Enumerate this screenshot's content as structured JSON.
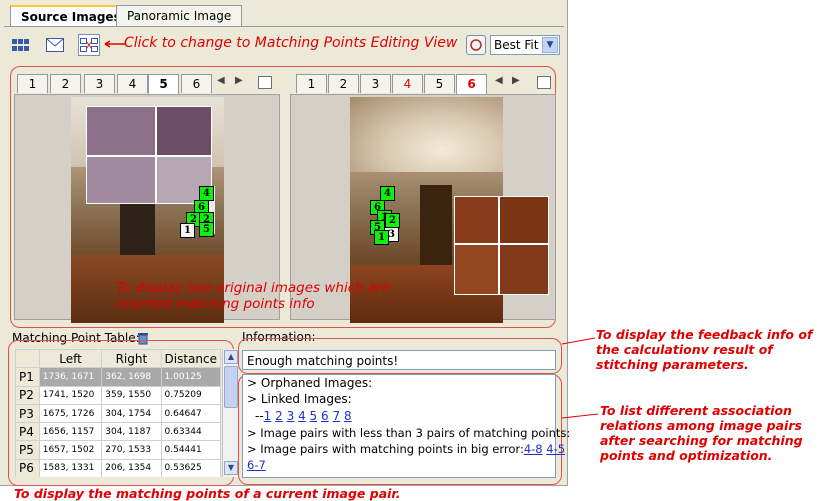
{
  "tabs": {
    "source_images": "Source Images",
    "panoramic_image": "Panoramic Image"
  },
  "toolbar": {
    "zoom_select": "Best Fit"
  },
  "instruction": "Click to change to Matching Points Editing View",
  "left_tabs": [
    "1",
    "2",
    "3",
    "4",
    "5",
    "6"
  ],
  "right_tabs": [
    "1",
    "2",
    "3",
    "4",
    "5",
    "6"
  ],
  "left_markers": [
    "4",
    "6",
    "2",
    "2",
    "5",
    "1"
  ],
  "right_markers": [
    "4",
    "6",
    "1",
    "2",
    "5",
    "3",
    "1"
  ],
  "overlay_caption": "To display two original images which are inserted matching points info",
  "table": {
    "title": "Matching Point Table:",
    "headers": [
      "",
      "Left",
      "Right",
      "Distance"
    ],
    "rows": [
      {
        "id": "P1",
        "left": "1736, 1671",
        "right": "362, 1698",
        "distance": "1.00125"
      },
      {
        "id": "P2",
        "left": "1741, 1520",
        "right": "359, 1550",
        "distance": "0.75209"
      },
      {
        "id": "P3",
        "left": "1675, 1726",
        "right": "304, 1754",
        "distance": "0.64647"
      },
      {
        "id": "P4",
        "left": "1656, 1157",
        "right": "304, 1187",
        "distance": "0.63344"
      },
      {
        "id": "P5",
        "left": "1657, 1502",
        "right": "270, 1533",
        "distance": "0.54441"
      },
      {
        "id": "P6",
        "left": "1583, 1331",
        "right": "206, 1354",
        "distance": "0.53625"
      }
    ]
  },
  "information": {
    "label": "Information:",
    "feedback": "Enough matching points!",
    "orphaned": "> Orphaned Images:",
    "linked": "> Linked Images:",
    "linked_prefix": "--",
    "linked_links": [
      "1",
      "2",
      "3",
      "4",
      "5",
      "6",
      "7",
      "8"
    ],
    "less_than_3": "> Image pairs with less than 3 pairs of matching points:",
    "big_error": "> Image pairs with matching points in big error:",
    "big_error_links": [
      "4-8",
      "4-5",
      "6-7"
    ]
  },
  "annotations": {
    "feedback": "To display the feedback info of the calculationv result of stitching parameters.",
    "relations": "To list different association relations among image pairs after searching for matching points and optimization.",
    "table_caption": "To display the matching points of a current image pair."
  }
}
